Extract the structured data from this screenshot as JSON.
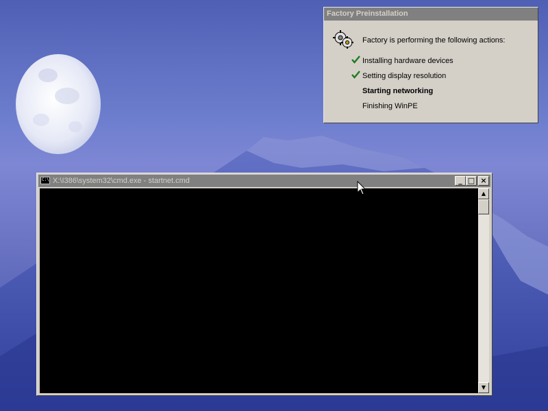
{
  "factory_dialog": {
    "title": "Factory Preinstallation",
    "heading": "Factory is performing the following actions:",
    "icon": "gears-icon",
    "steps": [
      {
        "label": "Installing hardware devices",
        "status": "done"
      },
      {
        "label": "Setting display resolution",
        "status": "done"
      },
      {
        "label": "Starting networking",
        "status": "in-progress"
      },
      {
        "label": "Finishing WinPE",
        "status": "pending"
      }
    ]
  },
  "cmd_window": {
    "title": "X:\\I386\\system32\\cmd.exe - startnet.cmd",
    "icon_glyph": "C:\\",
    "buttons": {
      "minimize": "_",
      "maximize": "□",
      "close": "×"
    },
    "scroll_up": "▲",
    "scroll_down": "▼"
  },
  "colors": {
    "check": "#1e7a1e",
    "dialog_face": "#d4d0c8",
    "inactive_titlebar": "#808080",
    "console_background": "#000000"
  }
}
